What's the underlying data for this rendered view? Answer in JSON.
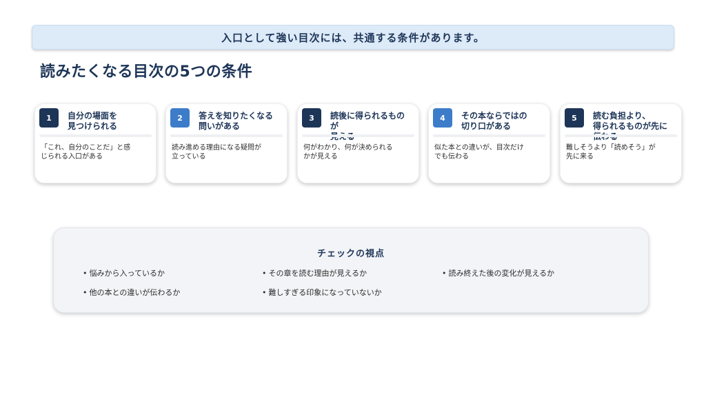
{
  "banner": {
    "text": "入口として強い目次には、共通する条件があります。"
  },
  "title": "読みたくなる目次の5つの条件",
  "cards": [
    {
      "num": "1",
      "heading": "自分の場面を\n見つけられる",
      "body": "「これ、自分のことだ」と感\nじられる入口がある",
      "num_color": "#1d3557"
    },
    {
      "num": "2",
      "heading": "答えを知りたくなる\n問いがある",
      "body": "読み進める理由になる疑問が\n立っている",
      "num_color": "#3d7cc9"
    },
    {
      "num": "3",
      "heading": "読後に得られるもの\nが\n見える",
      "body": "何がわかり、何が決められる\nかが見える",
      "num_color": "#1d3557"
    },
    {
      "num": "4",
      "heading": "その本ならではの\n切り口がある",
      "body": "似た本との違いが、目次だけ\nでも伝わる",
      "num_color": "#3d7cc9"
    },
    {
      "num": "5",
      "heading": "読む負担より、\n得られるものが先に\n伝わる",
      "body": "難しそうより「読めそう」が\n先に来る",
      "num_color": "#1d3557"
    }
  ],
  "check": {
    "title": "チェックの視点",
    "bullet": "•",
    "items": [
      "悩みから入っているか",
      "その章を読む理由が見えるか",
      "読み終えた後の変化が見えるか",
      "他の本との違いが伝わるか",
      "難しすぎる印象になっていないか"
    ]
  },
  "colors": {
    "navy": "#1d3557",
    "blue": "#3d7cc9",
    "banner_bg": "#ddeaf8",
    "panel_bg": "#f2f4f7"
  }
}
